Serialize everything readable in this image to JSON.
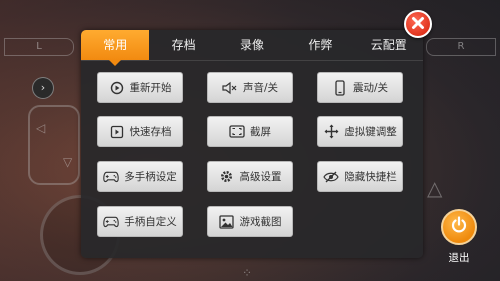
{
  "tabs": [
    {
      "label": "常用",
      "active": true
    },
    {
      "label": "存档",
      "active": false
    },
    {
      "label": "录像",
      "active": false
    },
    {
      "label": "作弊",
      "active": false
    },
    {
      "label": "云配置",
      "active": false
    }
  ],
  "buttons": [
    {
      "label": "重新开始",
      "icon": "restart-icon"
    },
    {
      "label": "声音/关",
      "icon": "sound-off-icon"
    },
    {
      "label": "震动/关",
      "icon": "vibration-icon"
    },
    {
      "label": "快速存档",
      "icon": "quick-save-icon"
    },
    {
      "label": "截屏",
      "icon": "screenshot-icon"
    },
    {
      "label": "虚拟键调整",
      "icon": "move-icon"
    },
    {
      "label": "多手柄设定",
      "icon": "gamepad-icon"
    },
    {
      "label": "高级设置",
      "icon": "gear-icon"
    },
    {
      "label": "隐藏快捷栏",
      "icon": "eye-hidden-icon"
    },
    {
      "label": "手柄自定义",
      "icon": "gamepad-icon"
    },
    {
      "label": "游戏截图",
      "icon": "image-icon"
    }
  ],
  "exit_label": "退出",
  "shoulder": {
    "left": "L",
    "right": "R"
  },
  "colors": {
    "accent": "#f28a10",
    "close": "#e0341e",
    "panel": "#28282a"
  }
}
